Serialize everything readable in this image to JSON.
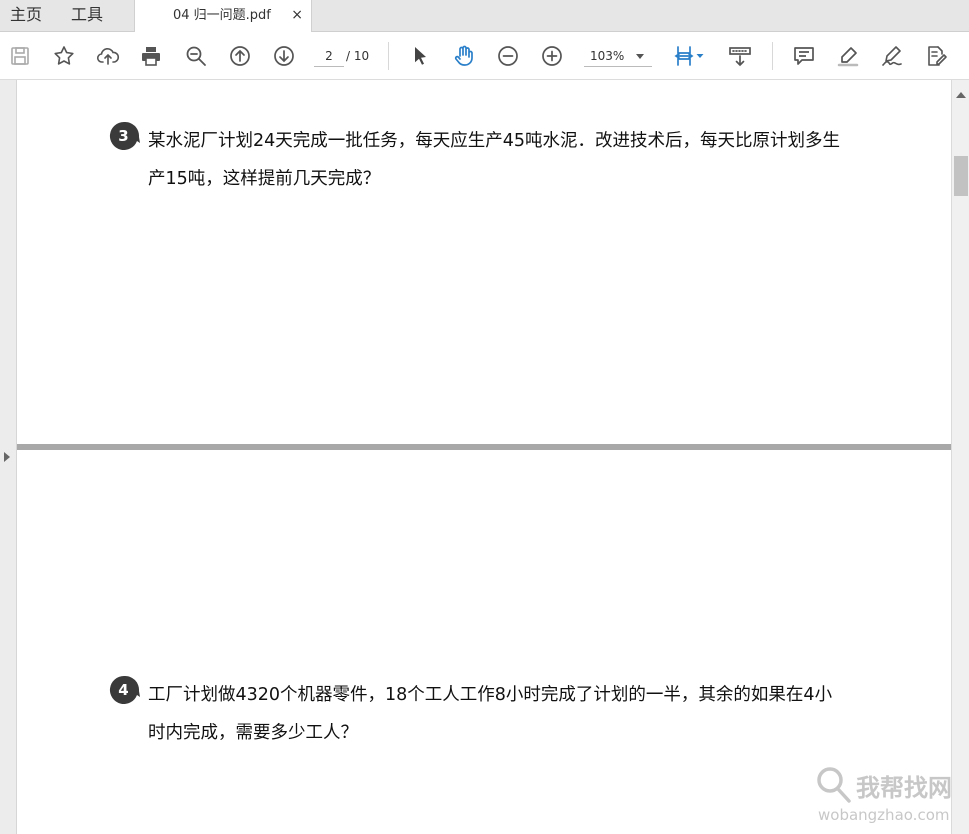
{
  "tabs": {
    "home": "主页",
    "tools": "工具",
    "document": "04 归一问题.pdf",
    "close": "×"
  },
  "toolbar": {
    "icons": [
      "save-icon",
      "bookmark-star-icon",
      "cloud-upload-icon",
      "print-icon",
      "zoom-search-icon",
      "page-up-icon",
      "page-down-icon",
      "select-cursor-icon",
      "hand-tool-icon",
      "zoom-out-icon",
      "zoom-in-icon",
      "fit-width-icon",
      "page-display-icon",
      "comment-icon",
      "highlight-icon",
      "sign-icon",
      "edit-pdf-icon"
    ],
    "current_page": "2",
    "total_pages": "/ 10",
    "zoom": "103%"
  },
  "document": {
    "questions": [
      {
        "number": "3",
        "text": "某水泥厂计划24天完成一批任务，每天应生产45吨水泥．改进技术后，每天比原计划多生产15吨，这样提前几天完成？"
      },
      {
        "number": "4",
        "text": "工厂计划做4320个机器零件，18个工人工作8小时完成了计划的一半，其余的如果在4小时内完成，需要多少工人？"
      }
    ]
  },
  "watermark": {
    "cn": "我帮找网",
    "en": "wobangzhao.com"
  },
  "colors": {
    "accent_blue": "#2a7fc9",
    "question_badge": "#3a3a3a",
    "page_gap": "#a8a8a8"
  }
}
